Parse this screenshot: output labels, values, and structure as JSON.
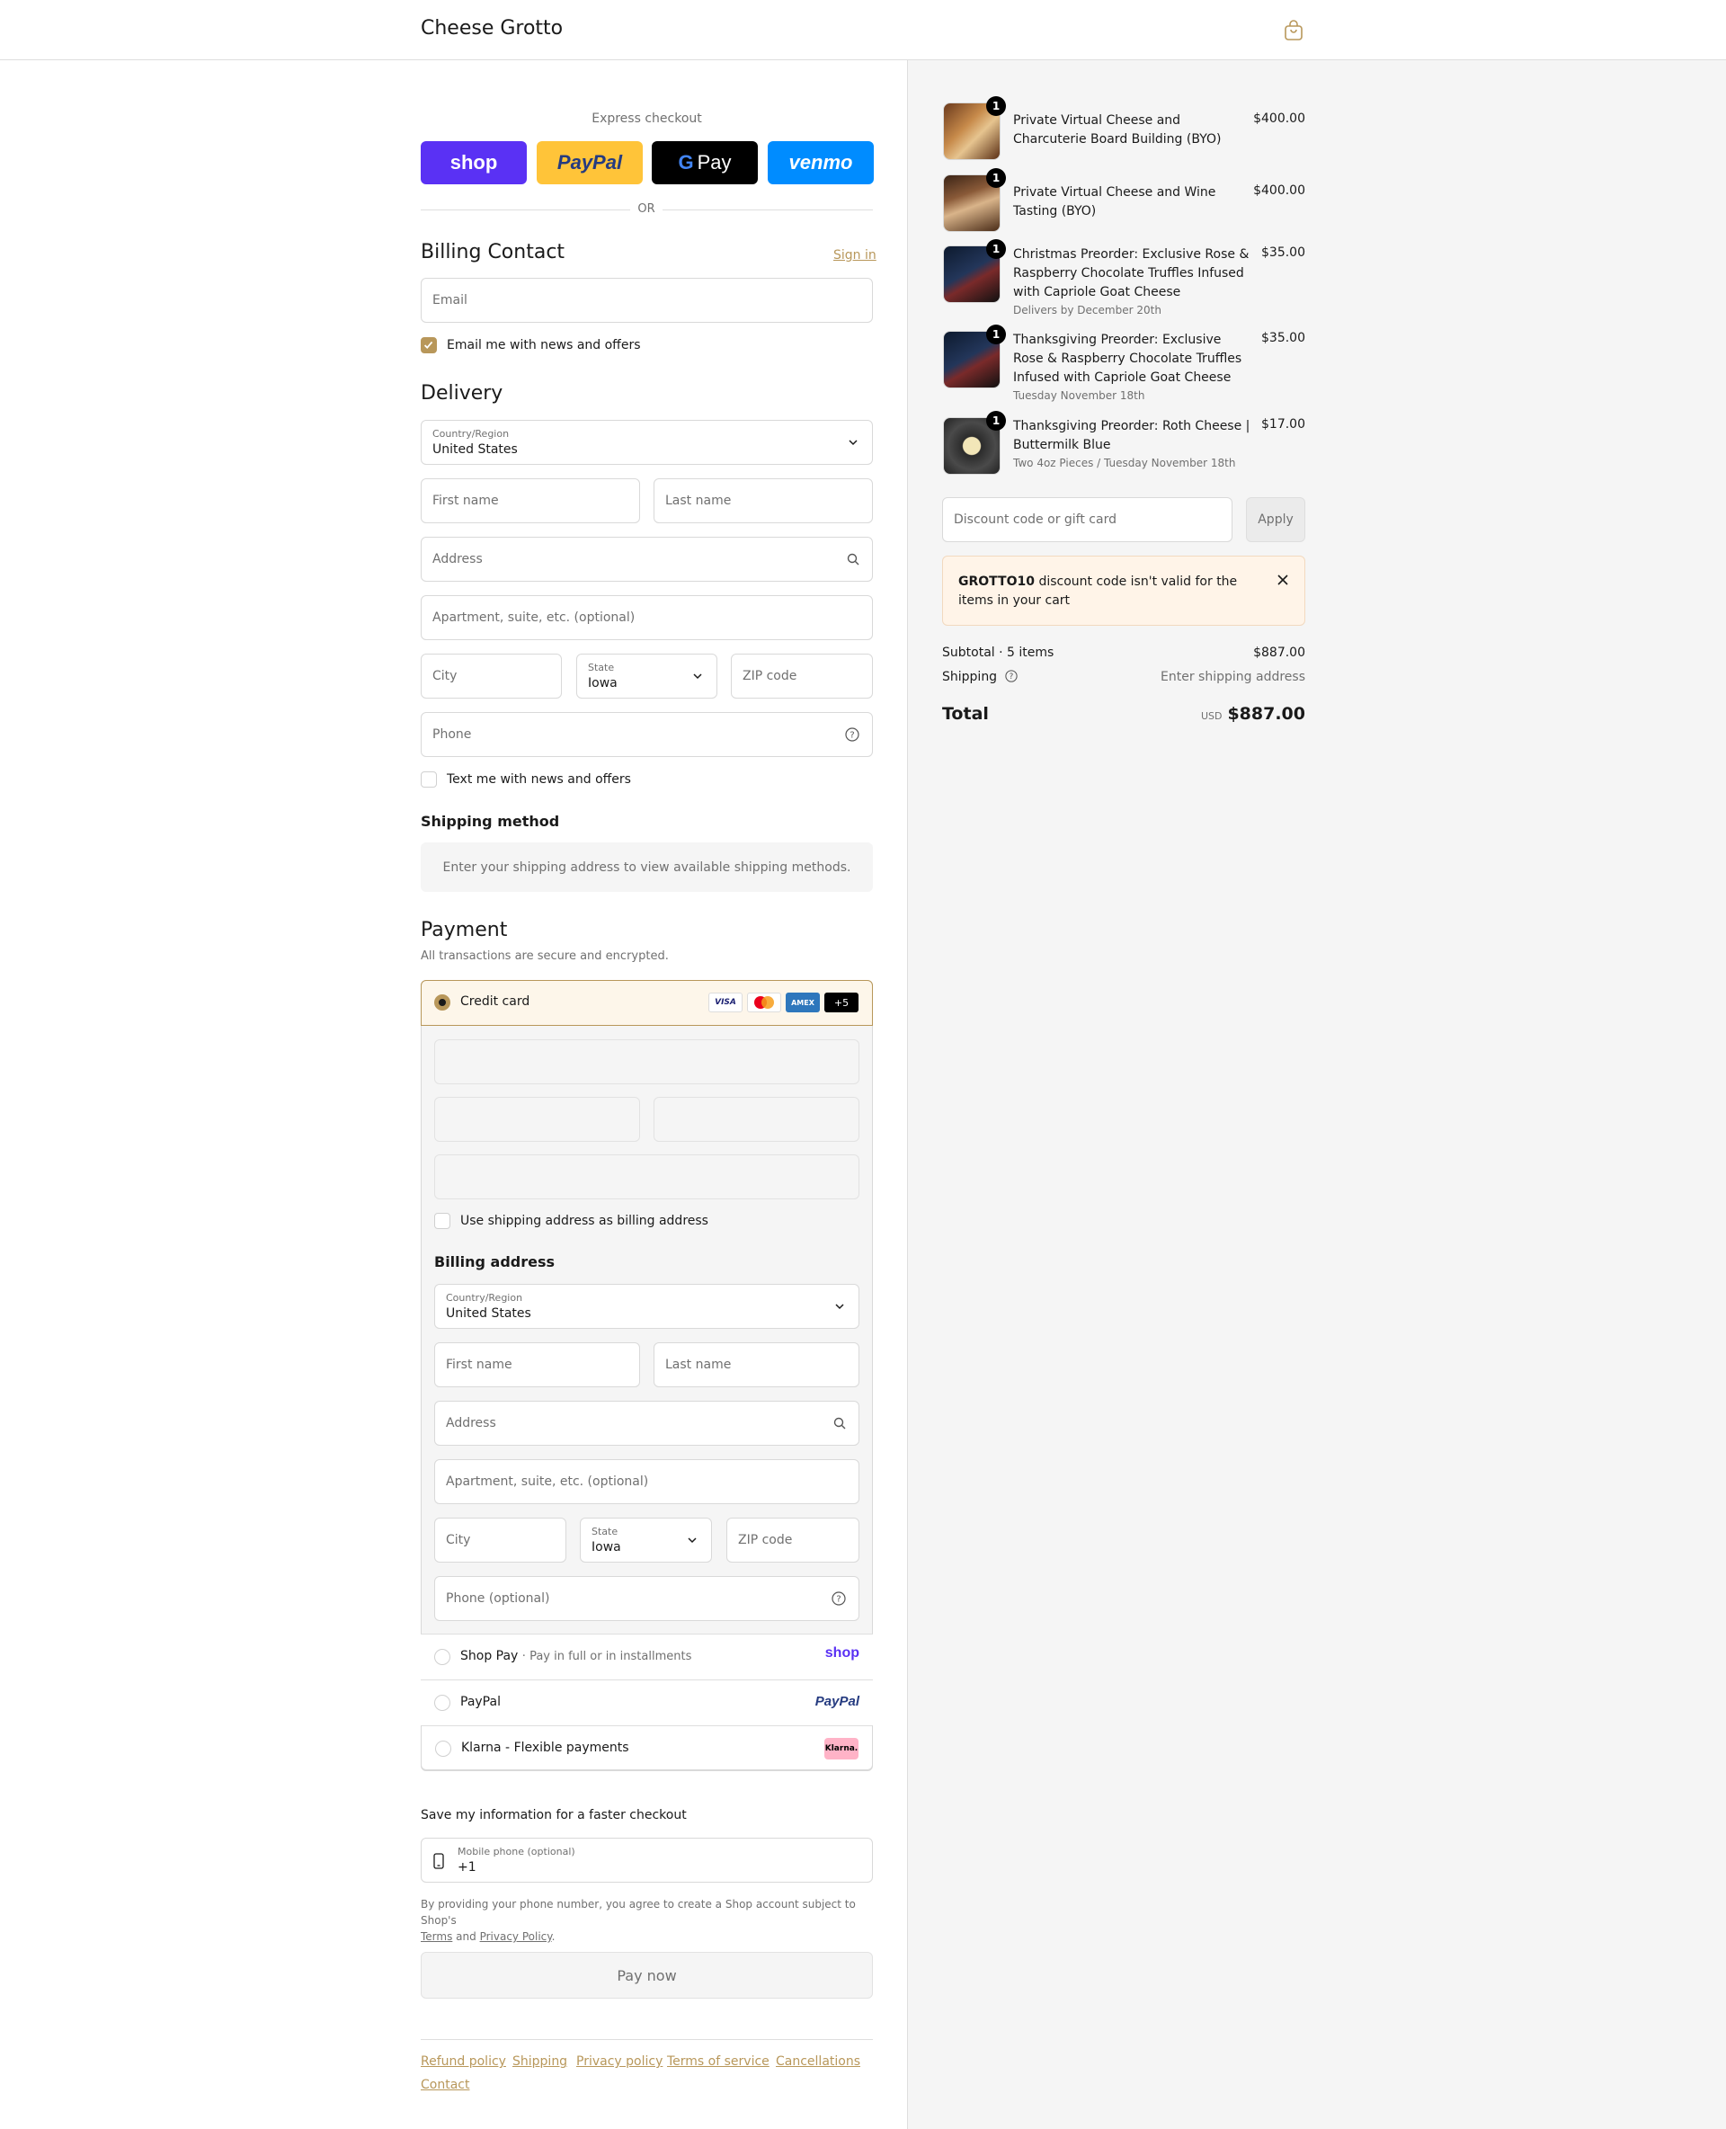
{
  "header": {
    "brand": "Cheese Grotto"
  },
  "express": {
    "label": "Express checkout",
    "shop": "shop",
    "paypal": "PayPal",
    "gpay": "Pay",
    "venmo": "venmo",
    "or": "OR"
  },
  "billing_contact": {
    "title": "Billing Contact",
    "sign_in": "Sign in",
    "email_placeholder": "Email",
    "email_news": "Email me with news and offers"
  },
  "delivery": {
    "title": "Delivery",
    "country_label": "Country/Region",
    "country_value": "United States",
    "first_name": "First name",
    "last_name": "Last name",
    "address": "Address",
    "apartment": "Apartment, suite, etc. (optional)",
    "city": "City",
    "state_label": "State",
    "state_value": "Iowa",
    "zip": "ZIP code",
    "phone": "Phone",
    "text_news": "Text me with news and offers"
  },
  "shipping_method": {
    "title": "Shipping method",
    "message": "Enter your shipping address to view available shipping methods."
  },
  "payment": {
    "title": "Payment",
    "subtitle": "All transactions are secure and encrypted.",
    "credit_card": "Credit card",
    "card_logos": [
      "VISA",
      "MC",
      "AMEX",
      "+5"
    ],
    "use_shipping": "Use shipping address as billing address",
    "billing_address_title": "Billing address",
    "country_label": "Country/Region",
    "country_value": "United States",
    "first_name": "First name",
    "last_name": "Last name",
    "address": "Address",
    "apartment": "Apartment, suite, etc. (optional)",
    "city": "City",
    "state_label": "State",
    "state_value": "Iowa",
    "zip": "ZIP code",
    "phone": "Phone (optional)",
    "shop_pay": "Shop Pay",
    "shop_pay_sub": "Pay in full or in installments",
    "shop_pay_logo": "shop",
    "paypal": "PayPal",
    "paypal_logo": "PayPal",
    "klarna": "Klarna - Flexible payments",
    "klarna_logo": "Klarna."
  },
  "save_info": {
    "title": "Save my information for a faster checkout",
    "mobile_label": "Mobile phone (optional)",
    "mobile_value": "+1",
    "disclaimer": "By providing your phone number, you agree to create a Shop account subject to Shop's",
    "terms": "Terms",
    "and": "and",
    "privacy": "Privacy Policy",
    "period": "."
  },
  "pay_now": "Pay now",
  "footer": [
    "Refund policy",
    "Shipping",
    "Privacy policy",
    "Terms of service",
    "Cancellations",
    "Contact"
  ],
  "cart": {
    "items": [
      {
        "title": "Private Virtual Cheese and Charcuterie Board Building (BYO)",
        "sub": "",
        "price": "$400.00",
        "qty": "1"
      },
      {
        "title": "Private Virtual Cheese and Wine Tasting (BYO)",
        "sub": "",
        "price": "$400.00",
        "qty": "1"
      },
      {
        "title": "Christmas Preorder: Exclusive Rose & Raspberry Chocolate Truffles Infused with Capriole Goat Cheese",
        "sub": "Delivers by December 20th",
        "price": "$35.00",
        "qty": "1"
      },
      {
        "title": "Thanksgiving Preorder: Exclusive Rose & Raspberry Chocolate Truffles Infused with Capriole Goat Cheese",
        "sub": "Tuesday November 18th",
        "price": "$35.00",
        "qty": "1"
      },
      {
        "title": "Thanksgiving Preorder: Roth Cheese | Buttermilk Blue",
        "sub": "Two 4oz Pieces / Tuesday November 18th",
        "price": "$17.00",
        "qty": "1"
      }
    ],
    "discount_placeholder": "Discount code or gift card",
    "apply": "Apply",
    "error_code": "GROTTO10",
    "error_text": "discount code isn't valid for the items in your cart",
    "subtotal_label": "Subtotal · 5 items",
    "subtotal_value": "$887.00",
    "shipping_label": "Shipping",
    "shipping_value": "Enter shipping address",
    "total_label": "Total",
    "currency": "USD",
    "total_value": "$887.00"
  },
  "colors": {
    "accent": "#b8975a",
    "shop": "#5a31f4",
    "paypal": "#ffc439",
    "venmo": "#008cff",
    "error_bg": "#fff4e8"
  }
}
